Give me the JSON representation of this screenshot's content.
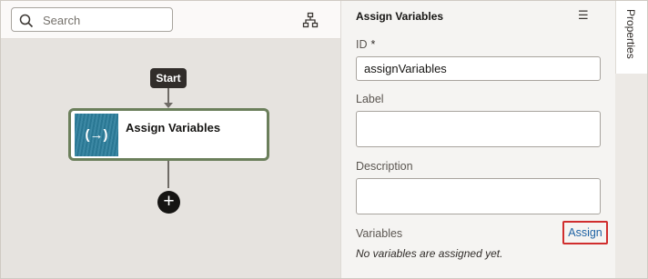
{
  "canvas": {
    "search": {
      "placeholder": "Search",
      "value": ""
    },
    "flow": {
      "start_label": "Start",
      "node": {
        "title": "Assign Variables",
        "icon_text": "(→)"
      },
      "add_icon": "+"
    }
  },
  "panel": {
    "title": "Assign Variables",
    "menu_icon": "☰",
    "id_label": "ID",
    "id_required_mark": "*",
    "id_value": "assignVariables",
    "label_label": "Label",
    "label_value": "",
    "description_label": "Description",
    "description_value": "",
    "variables_label": "Variables",
    "assign_label": "Assign",
    "empty_note": "No variables are assigned yet."
  },
  "side_tab": {
    "label": "Properties"
  },
  "colors": {
    "canvas_bg": "#e6e3df",
    "node_border": "#6b7f5b",
    "node_icon_bg": "#2c7e9c",
    "link": "#1f63a4",
    "highlight": "#d02e2e"
  }
}
